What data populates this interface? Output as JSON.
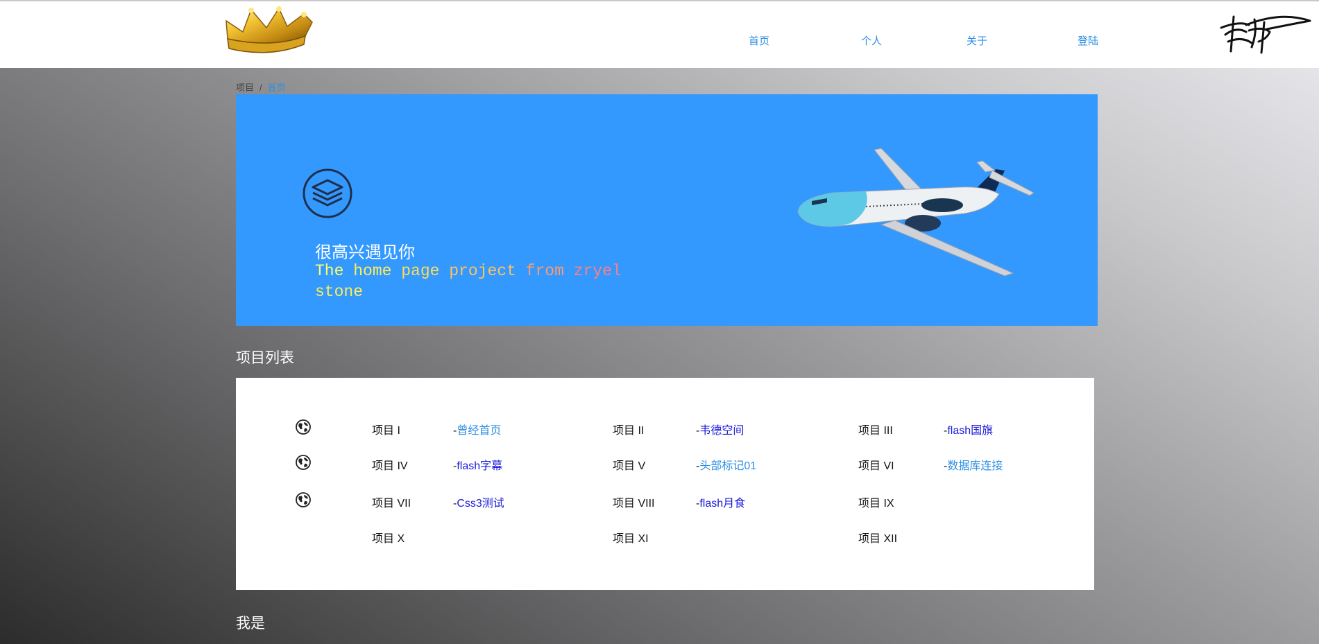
{
  "nav": {
    "items": [
      {
        "label": "首页"
      },
      {
        "label": "个人"
      },
      {
        "label": "关于"
      },
      {
        "label": "登陆"
      }
    ]
  },
  "breadcrumb": {
    "parent": "项目",
    "separator": "/",
    "current": "首页"
  },
  "hero": {
    "title": "很高兴遇见你",
    "subtitle_parts": [
      {
        "text": "The ",
        "color": "#ffff66"
      },
      {
        "text": "home ",
        "color": "#ffee55"
      },
      {
        "text": "page ",
        "color": "#ffdd55"
      },
      {
        "text": "project ",
        "color": "#ffc35c"
      },
      {
        "text": "from ",
        "color": "#ff9a6a"
      },
      {
        "text": "zryel",
        "color": "#ff7f82"
      },
      {
        "text": "stone",
        "color": "#ffee55"
      }
    ]
  },
  "projects_title": "项目列表",
  "about_title": "我是",
  "projects": {
    "row1": [
      {
        "label": "项目 I",
        "link": "曾经首页",
        "link_color": "#2d8fe3"
      },
      {
        "label": "项目 II",
        "link": "韦德空间",
        "link_color": "#1a1adb"
      },
      {
        "label": "项目 III",
        "link": "flash国旗",
        "link_color": "#1a1adb"
      }
    ],
    "row2": [
      {
        "label": "项目 IV",
        "link": "flash字幕",
        "link_color": "#1a1adb"
      },
      {
        "label": "项目 V",
        "link": "头部标记01",
        "link_color": "#2d8fe3"
      },
      {
        "label": "项目 VI",
        "link": "数据库连接",
        "link_color": "#2d8fe3"
      }
    ],
    "row3": [
      {
        "label": "项目 VII",
        "link": "Css3测试",
        "link_color": "#1a1adb"
      },
      {
        "label": "项目 VIII",
        "link": "flash月食",
        "link_color": "#1a1adb"
      },
      {
        "label": "项目 IX",
        "link": "",
        "link_color": ""
      }
    ],
    "row4": [
      {
        "label": "项目 X",
        "link": "",
        "link_color": ""
      },
      {
        "label": "项目 XI",
        "link": "",
        "link_color": ""
      },
      {
        "label": "项目 XII",
        "link": "",
        "link_color": ""
      }
    ]
  },
  "link_prefix": "-",
  "colors": {
    "accent": "#2d8fe3",
    "hero_bg": "#3399ff",
    "visited_link": "#1a1adb"
  },
  "icons": {
    "logo": "crown-icon",
    "banner": "layers-icon",
    "project_rows": "globe-icon",
    "signature": "signature-icon"
  }
}
